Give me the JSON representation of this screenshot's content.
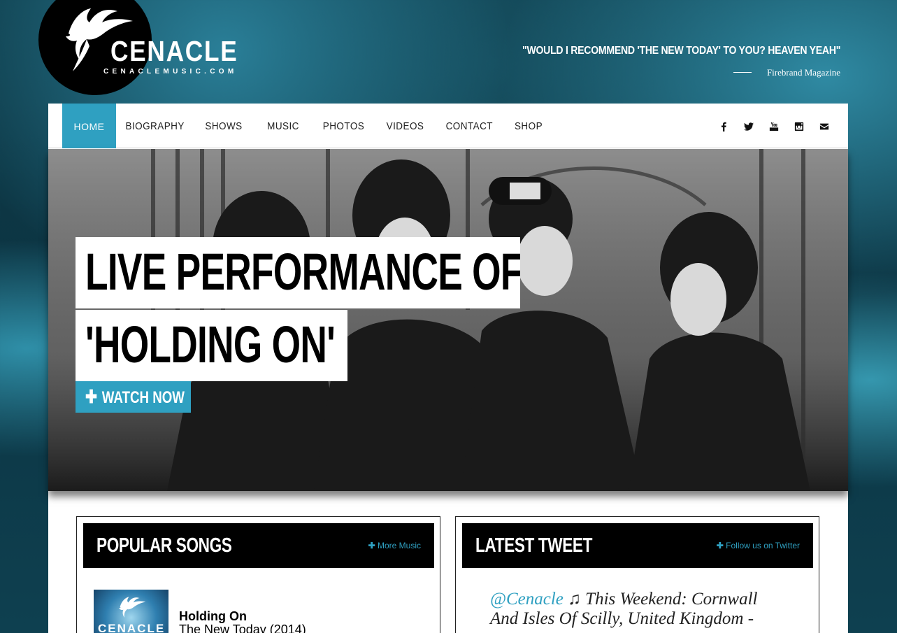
{
  "brand": {
    "name": "CENACLE",
    "url": "CENACLEMUSIC.COM"
  },
  "quote": {
    "text": "\"WOULD I RECOMMEND 'THE NEW TODAY' TO YOU? HEAVEN YEAH\"",
    "source": "Firebrand Magazine"
  },
  "nav": {
    "items": [
      {
        "label": "HOME",
        "active": true
      },
      {
        "label": "BIOGRAPHY"
      },
      {
        "label": "SHOWS"
      },
      {
        "label": "MUSIC"
      },
      {
        "label": "PHOTOS"
      },
      {
        "label": "VIDEOS"
      },
      {
        "label": "CONTACT"
      },
      {
        "label": "SHOP"
      }
    ],
    "social_icons": [
      "facebook-icon",
      "twitter-icon",
      "youtube-icon",
      "instagram-icon",
      "envelope-icon"
    ]
  },
  "hero": {
    "line1": "LIVE PERFORMANCE OF",
    "line2": "'HOLDING ON'",
    "button_label": "WATCH NOW",
    "button_icon": "plus-icon"
  },
  "popular_songs": {
    "title": "POPULAR SONGS",
    "link_label": "More Music",
    "items": [
      {
        "title": "Holding On",
        "album": "The New Today (2014)",
        "art_text": "CENACLE"
      }
    ]
  },
  "latest_tweet": {
    "title": "LATEST TWEET",
    "link_label": "Follow us on Twitter",
    "handle": "@Cenacle",
    "text": " ♫ This Weekend: Cornwall And Isles Of Scilly, United Kingdom -"
  },
  "colors": {
    "accent": "#2fa0c1",
    "panel": "#ffffff",
    "header_black": "#000000",
    "background": "#0f3d4b"
  }
}
